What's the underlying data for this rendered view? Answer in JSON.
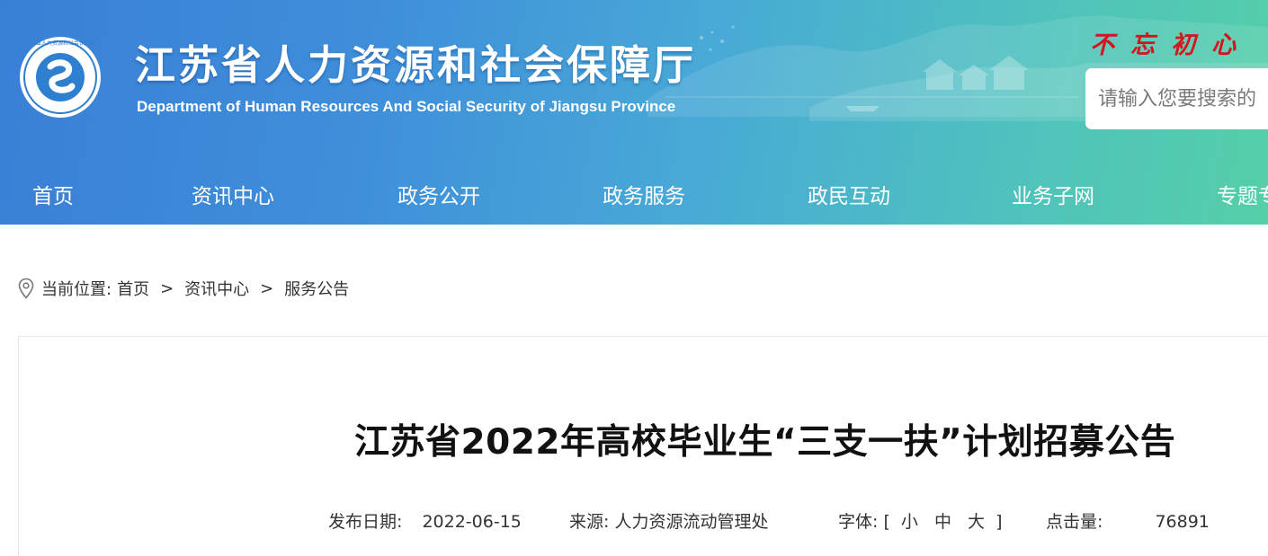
{
  "header": {
    "title_cn": "江苏省人力资源和社会保障厅",
    "title_en": "Department of Human Resources And Social Security of Jiangsu Province",
    "logo_text": "江苏省人力资源和社会保障厅",
    "slogan": "不忘初心",
    "search": {
      "placeholder": "请输入您要搜索的"
    }
  },
  "nav": {
    "items": [
      {
        "label": "首页"
      },
      {
        "label": "资讯中心"
      },
      {
        "label": "政务公开"
      },
      {
        "label": "政务服务"
      },
      {
        "label": "政民互动"
      },
      {
        "label": "业务子网"
      },
      {
        "label": "专题专"
      }
    ]
  },
  "breadcrumb": {
    "prefix": "当前位置:",
    "items": [
      "首页",
      "资讯中心",
      "服务公告"
    ],
    "separator": ">"
  },
  "article": {
    "title": "江苏省2022年高校毕业生“三支一扶”计划招募公告",
    "meta": {
      "date_label": "发布日期:",
      "date": "2022-06-15",
      "source_label": "来源:",
      "source": "人力资源流动管理处",
      "font_label": "字体:",
      "font_open": "[",
      "font_small": "小",
      "font_medium": "中",
      "font_large": "大",
      "font_close": "]",
      "hits_label": "点击量:",
      "hits": "76891"
    }
  },
  "colors": {
    "banner_start": "#3a7fd6",
    "banner_end": "#55cfa8",
    "slogan": "#d4151b",
    "logo": "#2f7fd1"
  }
}
